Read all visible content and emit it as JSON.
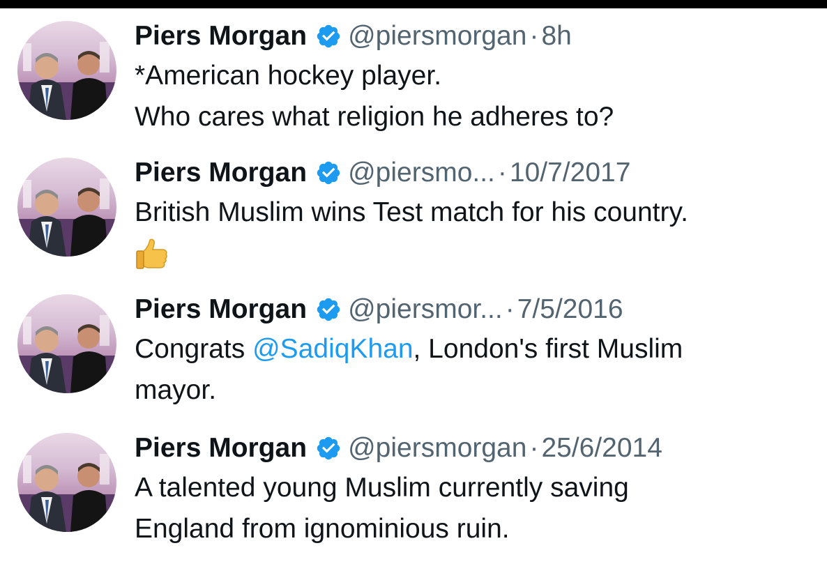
{
  "tweets": [
    {
      "name": "Piers Morgan",
      "handle": "@piersmorgan",
      "time": "8h",
      "lines": [
        "*American hockey player.",
        "Who cares what religion he adheres to?"
      ]
    },
    {
      "name": "Piers Morgan",
      "handle": "@piersmo...",
      "time": "10/7/2017",
      "lines": [
        "British Muslim wins Test match for his country."
      ],
      "emoji": "thumbs-up"
    },
    {
      "name": "Piers Morgan",
      "handle": "@piersmor...",
      "time": "7/5/2016",
      "line1_before": "Congrats ",
      "mention": "@SadiqKhan",
      "line1_after": ", London's first Muslim",
      "line2": "mayor."
    },
    {
      "name": "Piers Morgan",
      "handle": "@piersmorgan",
      "time": "25/6/2014",
      "lines": [
        "A talented young Muslim currently saving",
        "England from ignominious ruin."
      ]
    }
  ],
  "separator": "·",
  "icons": {
    "verified": "verified-badge-icon",
    "emoji": "thumbs-up-icon",
    "avatar": "avatar"
  },
  "colors": {
    "text": "#0f1419",
    "muted": "#536471",
    "link": "#1d9bf0",
    "verified": "#1d9bf0"
  }
}
